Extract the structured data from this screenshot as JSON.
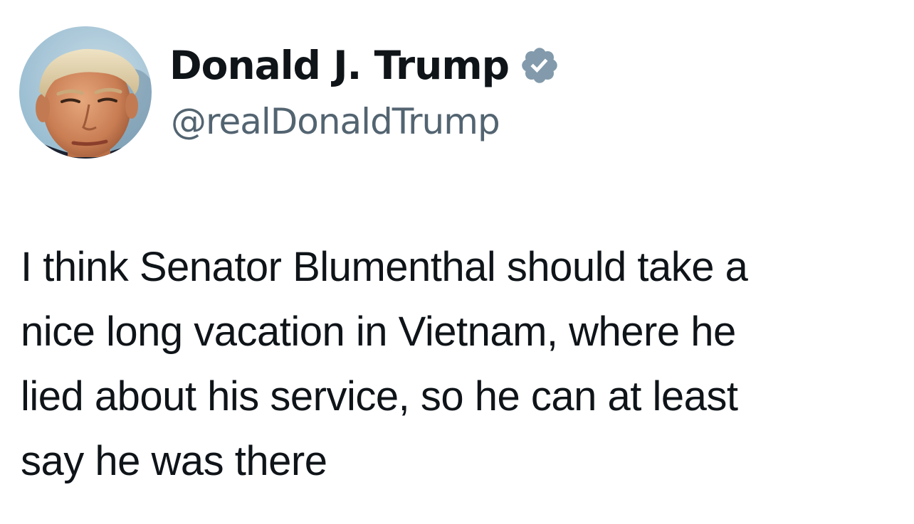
{
  "tweet": {
    "author": {
      "display_name": "Donald J. Trump",
      "handle": "@realDonaldTrump",
      "verified_icon": "verified-badge-icon",
      "verified_color": "#829aab"
    },
    "text_lines": [
      "I think Senator Blumenthal should take a",
      "nice long vacation in Vietnam, where he",
      "lied about his service, so he can at least",
      "say he was there"
    ]
  },
  "colors": {
    "text": "#0f1419",
    "handle": "#536471",
    "background": "#ffffff"
  }
}
